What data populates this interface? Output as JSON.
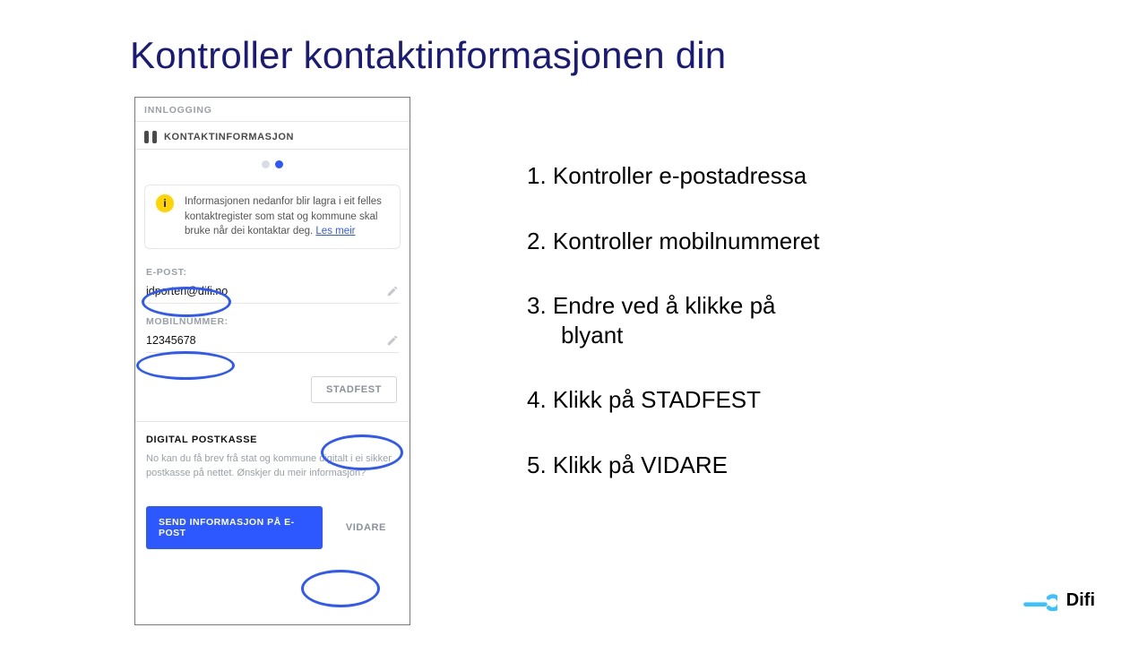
{
  "title": "Kontroller kontaktinformasjonen din",
  "phone": {
    "header": {
      "innlogging": "INNLOGGING",
      "kontaktinfo": "KONTAKTINFORMASJON"
    },
    "info": {
      "text": "Informasjonen nedanfor blir lagra i eit felles kontaktregister som stat og kommune skal bruke når dei kontaktar deg. ",
      "link": "Les meir"
    },
    "email": {
      "label": "E-POST:",
      "value": "idporten@difi.no"
    },
    "mobile": {
      "label": "MOBILNUMMER:",
      "value": "12345678"
    },
    "buttons": {
      "stadfest": "STADFEST",
      "send_info": "SEND INFORMASJON PÅ E-POST",
      "vidare": "VIDARE"
    },
    "postkasse": {
      "title": "DIGITAL POSTKASSE",
      "body": "No kan du få brev frå stat og kommune digitalt i ei sikker postkasse på nettet. Ønskjer du meir informasjon?"
    }
  },
  "steps": {
    "0": "1. Kontroller e-postadressa",
    "1": "2. Kontroller mobilnummeret",
    "2a": "3. Endre ved å klikke på",
    "2b": "blyant",
    "3": "4. Klikk på STADFEST",
    "4": "5. Klikk på VIDARE"
  },
  "logo": {
    "name": "Difi"
  }
}
